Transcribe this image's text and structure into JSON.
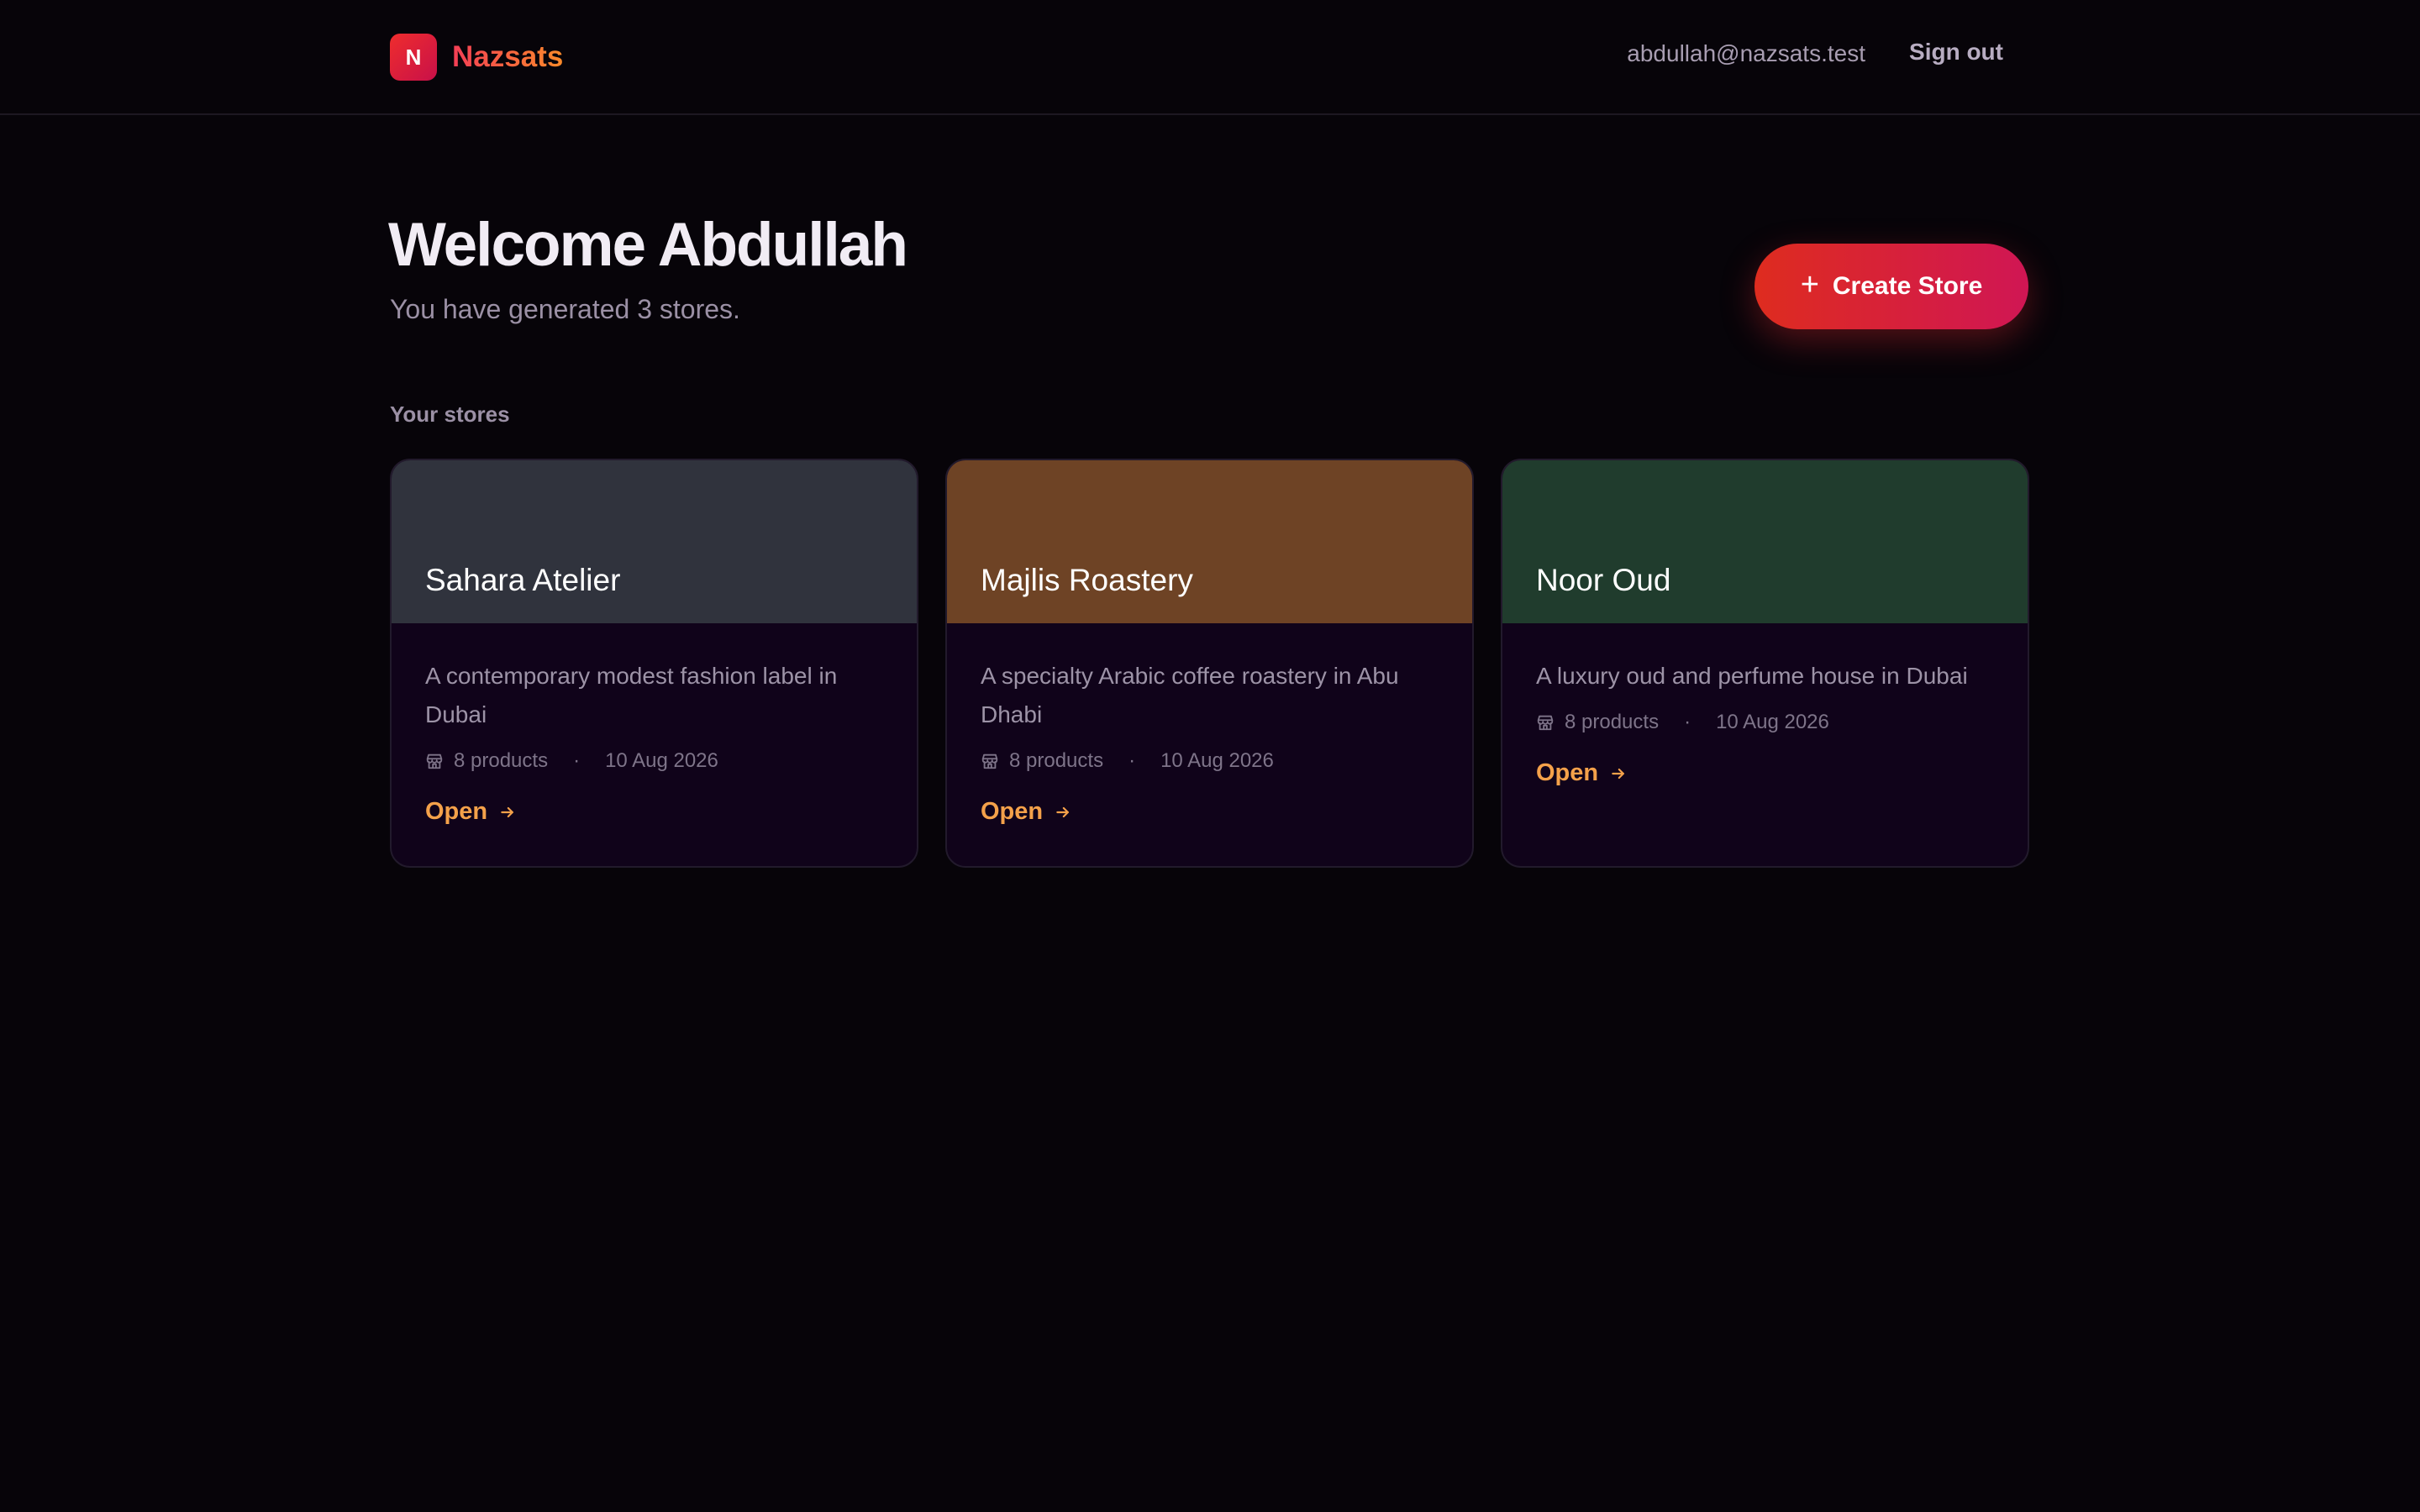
{
  "header": {
    "logo_letter": "N",
    "brand_name": "Nazsats",
    "user_email": "abdullah@nazsats.test",
    "sign_out_label": "Sign out"
  },
  "main": {
    "welcome": "Welcome Abdullah",
    "subtitle": "You have generated 3 stores.",
    "create_button_label": "Create Store",
    "section_label": "Your stores"
  },
  "stores": [
    {
      "name": "Sahara Atelier",
      "description": "A contemporary modest fashion label in Dubai",
      "products": "8 products",
      "date": "10 Aug 2026",
      "open_label": "Open",
      "color": "#30333d"
    },
    {
      "name": "Majlis Roastery",
      "description": "A specialty Arabic coffee roastery in Abu Dhabi",
      "products": "8 products",
      "date": "10 Aug 2026",
      "open_label": "Open",
      "color": "#6e4325"
    },
    {
      "name": "Noor Oud",
      "description": "A luxury oud and perfume house in Dubai",
      "products": "8 products",
      "date": "10 Aug 2026",
      "open_label": "Open",
      "color": "#203c2d"
    }
  ]
}
